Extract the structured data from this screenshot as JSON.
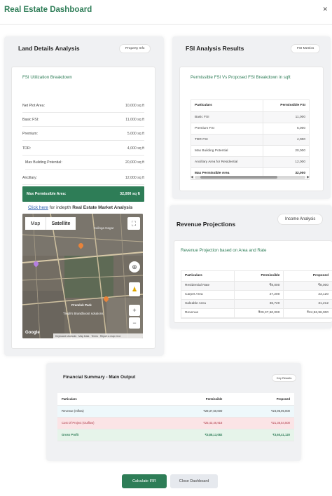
{
  "app": {
    "title": "Real Estate Dashboard"
  },
  "land": {
    "heading": "Land Details Analysis",
    "badge": "Property Info",
    "subheading": "FSI Utilization Breakdown",
    "rows": [
      {
        "label": "Net Plot Area:",
        "value": "10,000 sq ft"
      },
      {
        "label": "Basic FSI:",
        "value": "11,000 sq ft"
      },
      {
        "label": "Premium:",
        "value": "5,000 sq ft"
      },
      {
        "label": "TDR:",
        "value": "4,000 sq ft"
      },
      {
        "label": "Max Building Potential:",
        "value": "20,000 sq ft"
      },
      {
        "label": "Ancillary:",
        "value": "12,000 sq ft"
      }
    ],
    "max_label": "Max Permissible Area:",
    "max_value": "32,000 sq ft",
    "link_text": "Click here",
    "link_rest": " for indepth ",
    "link_bold": "Real Estate Market Analysis"
  },
  "map": {
    "tab_map": "Map",
    "tab_satellite": "Satellite",
    "footer": [
      "Keyboard shortcuts",
      "Map Data",
      "Terms",
      "Report a map error"
    ],
    "google": "Google",
    "labels": [
      "Kalinga Nagar",
      "Premlok Park",
      "Trepli's Brandboost solutions"
    ]
  },
  "fsi": {
    "heading": "FSI Analysis Results",
    "badge": "FSI Metrics",
    "subheading": "Permissible FSI Vs Proposed FSI Breakdown in sqft",
    "columns": [
      "Particulars",
      "Permissible FSI"
    ],
    "rows": [
      [
        "Basic FSI",
        "11,000"
      ],
      [
        "Premium FSI",
        "5,000"
      ],
      [
        "TDR FSI",
        "4,000"
      ],
      [
        "Max Building Potential",
        "20,000"
      ],
      [
        "Ancillary Area for Residential",
        "12,000"
      ],
      [
        "Max Permissible Area",
        "32,000"
      ]
    ]
  },
  "revenue": {
    "heading": "Revenue Projections",
    "badge": "Income Analysis",
    "subheading": "Revenue Projection based on Area and Rate",
    "columns": [
      "Particulars",
      "Permissible",
      "Proposed"
    ],
    "rows": [
      [
        "Residential Rate",
        "₹8,000",
        "₹8,000"
      ],
      [
        "Carpet Area",
        "27,200",
        "23,120"
      ],
      [
        "Saleable Area",
        "36,720",
        "31,212"
      ],
      [
        "Revenue",
        "₹29,37,60,000",
        "₹24,96,96,000"
      ]
    ]
  },
  "summary": {
    "heading": "Financial Summary - Main Output",
    "badge": "Key Results",
    "columns": [
      "Particulars",
      "Permissible",
      "Proposed"
    ],
    "rows": [
      [
        "Revenue (Inflow)",
        "₹29,37,60,000",
        "₹24,96,96,000"
      ],
      [
        "Cost Of Project (Outflow)",
        "₹25,43,46,918",
        "₹21,36,54,500"
      ],
      [
        "Gross Profit",
        "₹3,88,13,082",
        "₹3,60,41,120"
      ]
    ]
  },
  "buttons": {
    "calc": "Calculate IRR",
    "close": "Close Dashboard"
  },
  "colors": {
    "accent": "#2e7d57",
    "cost": "#b03a48",
    "revenue_bg": "#eef8fb",
    "profit_bg": "#e6f4ea"
  }
}
